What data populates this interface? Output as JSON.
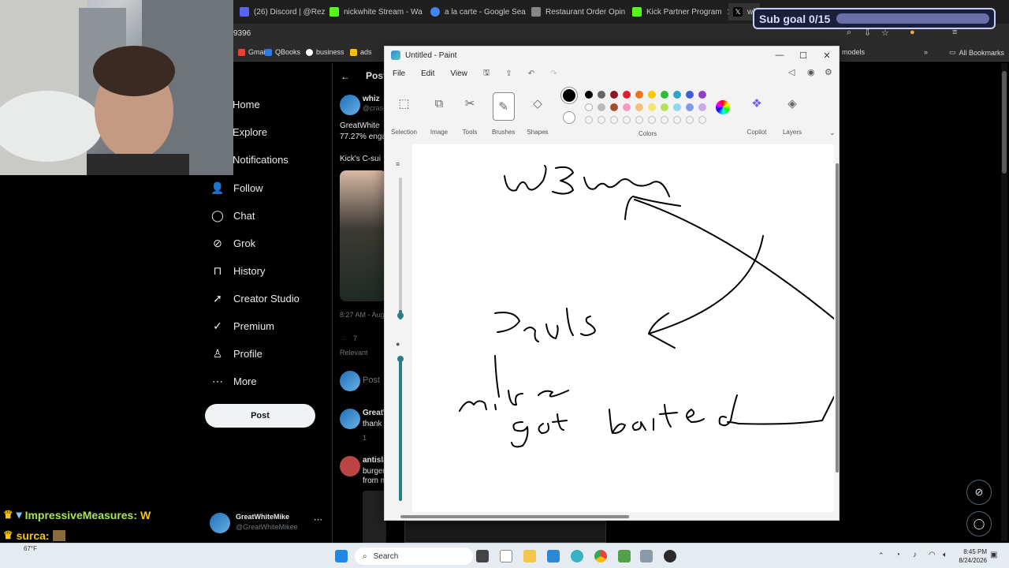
{
  "browser": {
    "tabs": [
      {
        "label": "(26) Discord | @Rez",
        "color": "#5865f2"
      },
      {
        "label": "nickwhite Stream - Wa",
        "color": "#53fc18"
      },
      {
        "label": "a la carte - Google Sea",
        "color": "#4285f4"
      },
      {
        "label": "Restaurant Order Opin",
        "color": "#888888"
      },
      {
        "label": "Kick Partner Program",
        "color": "#53fc18"
      },
      {
        "label": "whiz",
        "color": "#ffffff"
      }
    ],
    "address_fragment": "9396",
    "bookmarks": [
      "Gmail",
      "QBooks",
      "business",
      "ads"
    ],
    "bookmarks_right": [
      "models",
      "All Bookmarks"
    ]
  },
  "sub_goal": {
    "label": "Sub goal 0/15",
    "progress": 0
  },
  "x_sidebar": {
    "items": [
      {
        "label": "Home",
        "icon": "home-icon"
      },
      {
        "label": "Explore",
        "icon": "search-icon"
      },
      {
        "label": "Notifications",
        "icon": "bell-icon"
      },
      {
        "label": "Follow",
        "icon": "follow-icon"
      },
      {
        "label": "Chat",
        "icon": "chat-icon"
      },
      {
        "label": "Grok",
        "icon": "grok-icon"
      },
      {
        "label": "History",
        "icon": "bookmark-icon"
      },
      {
        "label": "Creator Studio",
        "icon": "rocket-icon"
      },
      {
        "label": "Premium",
        "icon": "verified-icon"
      },
      {
        "label": "Profile",
        "icon": "person-icon"
      },
      {
        "label": "More",
        "icon": "more-icon"
      }
    ],
    "post_button": "Post",
    "account_name": "GreatWhiteMike",
    "account_handle": "@GreatWhiteMikee"
  },
  "x_main": {
    "header": "Post",
    "author": "whiz",
    "author_handle": "@cras",
    "text_line1": "GreatWhite",
    "text_line2": "77.27% enga",
    "text_line3": "Kick's C-sui",
    "timestamp": "8:27 AM - Aug",
    "reply_count": "7",
    "sort": "Relevant",
    "compose_placeholder": "Post",
    "reply1_author": "GreatW",
    "reply1_text": "thank",
    "reply1_count": "1",
    "reply2_author": "antisla",
    "reply2_line1": "burger",
    "reply2_line2": "from m"
  },
  "chat_overlay": [
    {
      "user": "ImpressiveMeasures:",
      "msg": "W"
    },
    {
      "user": "surca:",
      "msg": ""
    }
  ],
  "paint": {
    "title": "Untitled - Paint",
    "menu": [
      "File",
      "Edit",
      "View"
    ],
    "tools": [
      {
        "label": "Selection",
        "icon": "selection-icon"
      },
      {
        "label": "Image",
        "icon": "image-icon"
      },
      {
        "label": "Tools",
        "icon": "tools-icon"
      },
      {
        "label": "Brushes",
        "icon": "brush-icon"
      },
      {
        "label": "Shapes",
        "icon": "shapes-icon"
      }
    ],
    "colors_label": "Colors",
    "copilot_label": "Copilot",
    "layers_label": "Layers",
    "palette_row1": [
      "#000000",
      "#666666",
      "#8b1a1a",
      "#e0202a",
      "#f0741e",
      "#f8c800",
      "#2ebd3a",
      "#2aa6c8",
      "#3d5fd6",
      "#9240c8"
    ],
    "palette_row2": [
      "#ffffff",
      "#b9b9b9",
      "#a0522d",
      "#f39ac0",
      "#f2c280",
      "#f4e770",
      "#b6e05a",
      "#8fd8ef",
      "#7f9be8",
      "#c7a8e8"
    ]
  },
  "taskbar": {
    "search_label": "Search",
    "weather": "67°F",
    "time": "8:45 PM",
    "date": "8/24/2026"
  }
}
